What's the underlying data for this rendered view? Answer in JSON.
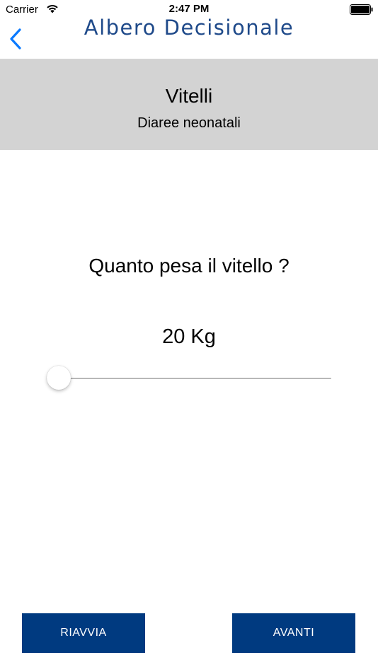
{
  "status_bar": {
    "carrier": "Carrier",
    "time": "2:47 PM",
    "icons": [
      "wifi-icon",
      "battery-icon"
    ]
  },
  "nav": {
    "title": "Albero Decisionale",
    "back_icon": "chevron-left-icon",
    "title_color": "#1f4a8a",
    "back_color": "#0a7aff"
  },
  "header": {
    "title": "Vitelli",
    "subtitle": "Diaree neonatali",
    "background": "#d3d3d3"
  },
  "question": {
    "text": "Quanto pesa il vitello ?",
    "value_label": "20 Kg"
  },
  "slider": {
    "fraction": 0.0
  },
  "buttons": {
    "restart_label": "RIAVVIA",
    "next_label": "AVANTI",
    "color": "#003a80"
  }
}
